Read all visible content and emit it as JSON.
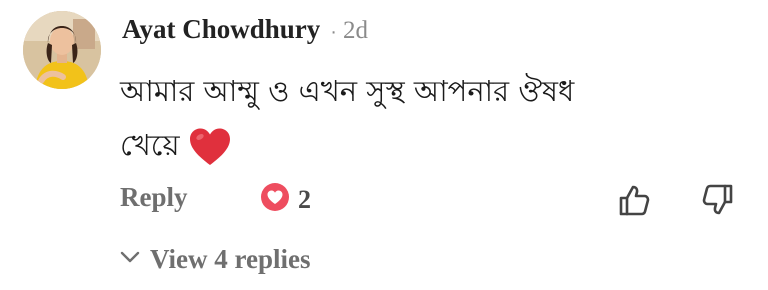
{
  "comment": {
    "author": "Ayat Chowdhury",
    "separator": "·",
    "age": "2d",
    "body_lines": [
      "আমার আম্মু ও এখন সুস্থ আপনার  ঔষধ",
      "খেয়ে"
    ],
    "body_emoji": "heart-emoji"
  },
  "actions": {
    "reply_label": "Reply",
    "reaction_icon": "heart-reaction-icon",
    "reaction_count": "2",
    "like_icon": "thumbs-up-icon",
    "dislike_icon": "thumbs-down-icon"
  },
  "replies": {
    "toggle_icon": "chevron-down-icon",
    "label": "View 4 replies"
  },
  "colors": {
    "author": "#222222",
    "meta": "#8a8a8a",
    "action_text": "#6f6f6f",
    "heart": "#e0303d"
  }
}
